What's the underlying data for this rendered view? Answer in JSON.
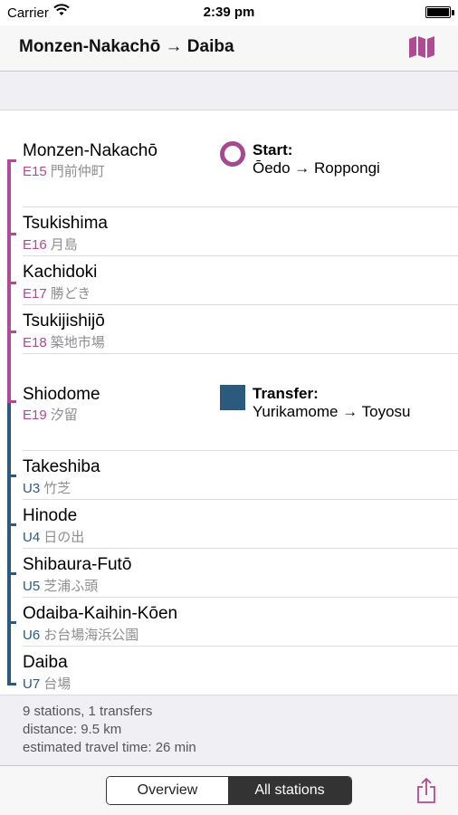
{
  "status": {
    "carrier": "Carrier",
    "time": "2:39 pm"
  },
  "nav": {
    "title": "Monzen-Nakachō → Daiba",
    "map_icon": "map-icon"
  },
  "colors": {
    "oedo": "#b04a95",
    "yurikamome": "#2b5a7e"
  },
  "stations": [
    {
      "name": "Monzen-Nakachō",
      "code": "E15",
      "jp": "門前仲町"
    },
    {
      "name": "Tsukishima",
      "code": "E16",
      "jp": "月島"
    },
    {
      "name": "Kachidoki",
      "code": "E17",
      "jp": "勝どき"
    },
    {
      "name": "Tsukijishijō",
      "code": "E18",
      "jp": "築地市場"
    },
    {
      "name": "Shiodome",
      "code": "E19",
      "jp": "汐留"
    },
    {
      "name": "Takeshiba",
      "code": "U3",
      "jp": "竹芝"
    },
    {
      "name": "Hinode",
      "code": "U4",
      "jp": "日の出"
    },
    {
      "name": "Shibaura-Futō",
      "code": "U5",
      "jp": "芝浦ふ頭"
    },
    {
      "name": "Odaiba-Kaihin-Kōen",
      "code": "U6",
      "jp": "お台場海浜公園"
    },
    {
      "name": "Daiba",
      "code": "U7",
      "jp": "台場"
    }
  ],
  "start": {
    "title": "Start:",
    "route": "Ōedo → Roppongi"
  },
  "transfer": {
    "title": "Transfer:",
    "route": "Yurikamome → Toyosu"
  },
  "summary": {
    "line1": "9 stations, 1 transfers",
    "line2": "distance: 9.5 km",
    "line3": "estimated travel time: 26 min"
  },
  "toolbar": {
    "overview": "Overview",
    "all_stations": "All stations",
    "selected": "All stations",
    "share_icon": "share-icon"
  }
}
